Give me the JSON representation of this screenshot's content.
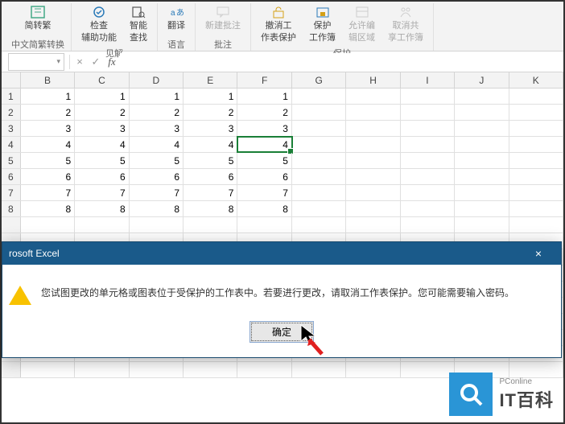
{
  "ribbon": {
    "groups": [
      {
        "label": "中文简繁转换",
        "items": [
          {
            "name": "simp-trad-toggle",
            "line1": "简转繁",
            "line2": ""
          }
        ]
      },
      {
        "label": "",
        "items": [
          {
            "name": "check-aux",
            "line1": "检查",
            "line2": "辅助功能"
          },
          {
            "name": "smart-find",
            "line1": "智能",
            "line2": "查找"
          }
        ],
        "group_label": "见解"
      },
      {
        "label": "语言",
        "items": [
          {
            "name": "translate",
            "line1": "翻译",
            "line2": ""
          }
        ]
      },
      {
        "label": "批注",
        "items": [
          {
            "name": "new-comment",
            "line1": "新建批注",
            "line2": "",
            "disabled": true
          }
        ]
      },
      {
        "label": "保护",
        "items": [
          {
            "name": "unprotect-sheet",
            "line1": "撤消工",
            "line2": "作表保护"
          },
          {
            "name": "protect-workbook",
            "line1": "保护",
            "line2": "工作簿"
          },
          {
            "name": "allow-edit-ranges",
            "line1": "允许编",
            "line2": "辑区域",
            "disabled": true
          },
          {
            "name": "unshare-workbook",
            "line1": "取消共",
            "line2": "享工作簿",
            "disabled": true
          }
        ]
      }
    ]
  },
  "formula_bar": {
    "namebox": "",
    "fx": "fx",
    "value": ""
  },
  "columns": [
    "B",
    "C",
    "D",
    "E",
    "F",
    "G",
    "H",
    "I",
    "J",
    "K"
  ],
  "rows": [
    {
      "h": "1",
      "cells": [
        "1",
        "1",
        "1",
        "1",
        "1",
        "",
        "",
        "",
        "",
        ""
      ]
    },
    {
      "h": "2",
      "cells": [
        "2",
        "2",
        "2",
        "2",
        "2",
        "",
        "",
        "",
        "",
        ""
      ]
    },
    {
      "h": "3",
      "cells": [
        "3",
        "3",
        "3",
        "3",
        "3",
        "",
        "",
        "",
        "",
        ""
      ]
    },
    {
      "h": "4",
      "cells": [
        "4",
        "4",
        "4",
        "4",
        "4",
        "",
        "",
        "",
        "",
        ""
      ]
    },
    {
      "h": "5",
      "cells": [
        "5",
        "5",
        "5",
        "5",
        "5",
        "",
        "",
        "",
        "",
        ""
      ]
    },
    {
      "h": "6",
      "cells": [
        "6",
        "6",
        "6",
        "6",
        "6",
        "",
        "",
        "",
        "",
        ""
      ]
    },
    {
      "h": "7",
      "cells": [
        "7",
        "7",
        "7",
        "7",
        "7",
        "",
        "",
        "",
        "",
        ""
      ]
    },
    {
      "h": "8",
      "cells": [
        "8",
        "8",
        "8",
        "8",
        "8",
        "",
        "",
        "",
        "",
        ""
      ]
    }
  ],
  "selected": {
    "row": 3,
    "col": 4
  },
  "dialog": {
    "title": "rosoft Excel",
    "message": "您试图更改的单元格或图表位于受保护的工作表中。若要进行更改，请取消工作表保护。您可能需要输入密码。",
    "ok": "确定",
    "close": "×"
  },
  "watermark": {
    "small": "PConline",
    "big": "IT百科"
  }
}
